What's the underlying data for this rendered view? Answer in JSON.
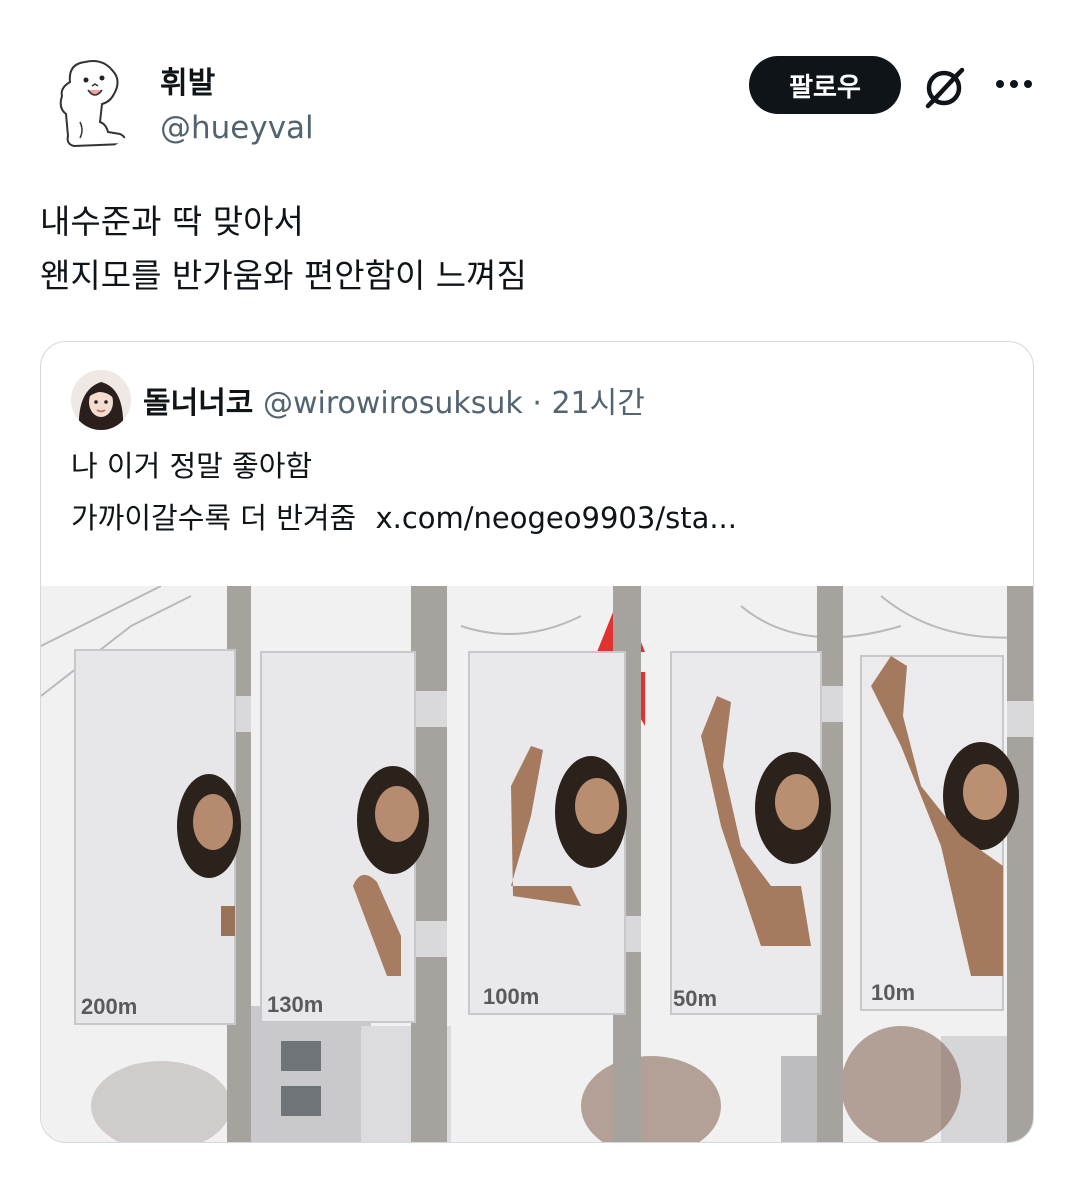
{
  "author": {
    "name": "휘발",
    "handle": "@hueyval"
  },
  "actions": {
    "follow_label": "팔로우",
    "grok_icon": "grok-icon",
    "more_icon": "more-icon"
  },
  "tweet": {
    "lines": [
      "내수준과 딱 맞아서",
      "왠지모를 반가움와 편안함이 느껴짐"
    ]
  },
  "quote": {
    "name": "돌너너코",
    "handle": "@wirowirosuksuk",
    "separator": "·",
    "time": "21시간",
    "line1": "나 이거 정말 좋아함",
    "line2": "가까이갈수록 더 반겨줌",
    "link": "x.com/neogeo9903/sta...",
    "image": {
      "distances": [
        "200m",
        "130m",
        "100m",
        "50m",
        "10m"
      ]
    }
  },
  "colors": {
    "text": "#0f1419",
    "secondary": "#536471",
    "border": "#cfd9de",
    "button_bg": "#0f1419"
  }
}
